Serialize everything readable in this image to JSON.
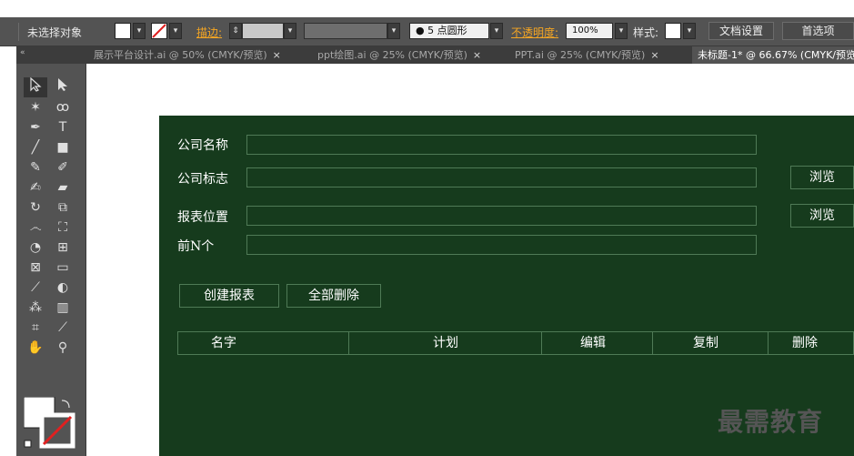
{
  "control_bar": {
    "selection_status": "未选择对象",
    "stroke_label": "描边:",
    "brush_value": "5 点圆形",
    "opacity_label": "不透明度:",
    "opacity_value": "100%",
    "style_label": "样式:",
    "doc_setup_label": "文档设置",
    "prefs_label": "首选项"
  },
  "tabs": [
    {
      "label": "展示平台设计.ai @ 50% (CMYK/预览)"
    },
    {
      "label": "ppt绘图.ai @ 25% (CMYK/预览)"
    },
    {
      "label": "PPT.ai @ 25% (CMYK/预览)"
    },
    {
      "label": "未标题-1* @ 66.67% (CMYK/预览)"
    }
  ],
  "tab_close_glyph": "×",
  "tools_grip": "«",
  "tool_icons": [
    "selection-tool-icon",
    "direct-selection-tool-icon",
    "magic-wand-tool-icon",
    "lasso-tool-icon",
    "pen-tool-icon",
    "type-tool-icon",
    "line-tool-icon",
    "rectangle-tool-icon",
    "paintbrush-tool-icon",
    "pencil-tool-icon",
    "blob-brush-tool-icon",
    "eraser-tool-icon",
    "rotate-tool-icon",
    "scale-tool-icon",
    "warp-tool-icon",
    "free-transform-tool-icon",
    "shape-builder-tool-icon",
    "perspective-grid-tool-icon",
    "mesh-tool-icon",
    "gradient-tool-icon",
    "eyedropper-tool-icon",
    "blend-tool-icon",
    "symbol-sprayer-tool-icon",
    "column-graph-tool-icon",
    "artboard-tool-icon",
    "slice-tool-icon",
    "hand-tool-icon",
    "zoom-tool-icon"
  ],
  "form": {
    "company_name_label": "公司名称",
    "company_logo_label": "公司标志",
    "report_location_label": "报表位置",
    "top_n_label": "前N个",
    "browse_label": "浏览",
    "create_report_label": "创建报表",
    "delete_all_label": "全部删除"
  },
  "table": {
    "headers": [
      "名字",
      "计划",
      "编辑",
      "复制",
      "删除"
    ]
  },
  "watermark": "最需教育",
  "colors": {
    "board_bg": "#163b1d",
    "board_border": "#4f7a56",
    "chrome_bg": "#535353",
    "tab_bar_bg": "#3c3c3c",
    "accent_orange": "#f5a623"
  }
}
